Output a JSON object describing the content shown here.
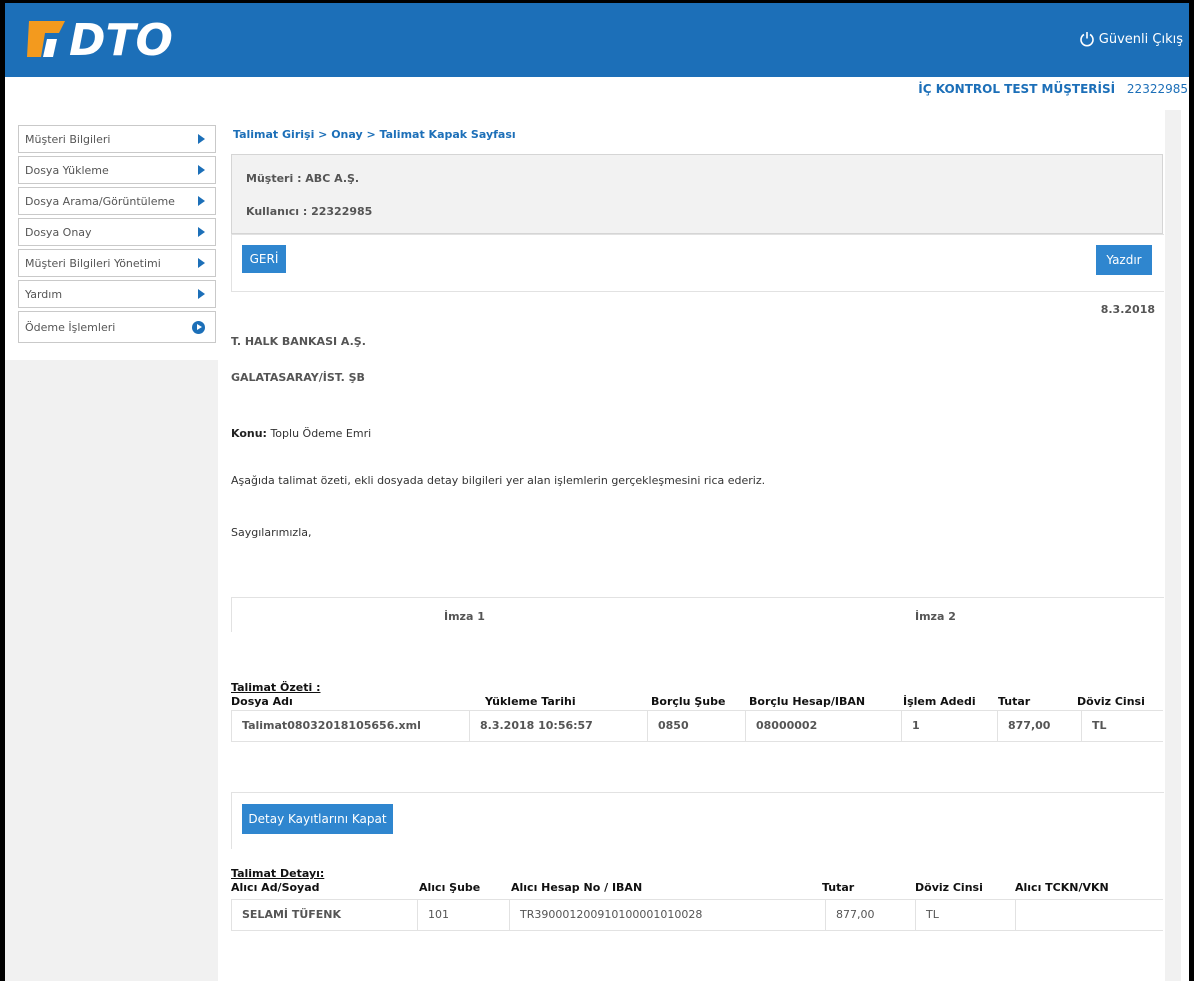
{
  "header": {
    "logo_text": "DTO",
    "logout_label": "Güvenli Çıkış"
  },
  "customer": {
    "name": "İÇ KONTROL TEST MÜŞTERİSİ",
    "number": "22322985"
  },
  "sidebar": {
    "items": [
      {
        "label": "Müşteri Bilgileri"
      },
      {
        "label": "Dosya Yükleme"
      },
      {
        "label": "Dosya Arama/Görüntüleme"
      },
      {
        "label": "Dosya Onay"
      },
      {
        "label": "Müşteri Bilgileri Yönetimi"
      },
      {
        "label": "Yardım"
      },
      {
        "label": "Ödeme İşlemleri"
      }
    ]
  },
  "breadcrumb": "Talimat Girişi > Onay > Talimat Kapak Sayfası",
  "info": {
    "customer_line": "Müşteri : ABC A.Ş.",
    "user_line": "Kullanıcı : 22322985"
  },
  "buttons": {
    "back": "GERİ",
    "print": "Yazdır",
    "close_details": "Detay Kayıtlarını Kapat"
  },
  "letter": {
    "date": "8.3.2018",
    "bank": "T. HALK BANKASI A.Ş.",
    "branch": "GALATASARAY/İST. ŞB",
    "subject_label": "Konu:",
    "subject": "Toplu Ödeme Emri",
    "body": "Aşağıda talimat özeti, ekli dosyada detay bilgileri yer alan işlemlerin gerçekleşmesini rica ederiz.",
    "regards": "Saygılarımızla,"
  },
  "signatures": {
    "sign1": "İmza 1",
    "sign2": "İmza 2"
  },
  "summary": {
    "title": "Talimat Özeti :",
    "headers": [
      "Dosya Adı",
      "Yükleme Tarihi",
      "Borçlu Şube",
      "Borçlu Hesap/IBAN",
      "İşlem Adedi",
      "Tutar",
      "Döviz Cinsi"
    ],
    "row": [
      "Talimat08032018105656.xml",
      "8.3.2018 10:56:57",
      "0850",
      "08000002",
      "1",
      "877,00",
      "TL"
    ]
  },
  "detail": {
    "title": "Talimat Detayı:",
    "headers": [
      "Alıcı Ad/Soyad",
      "Alıcı Şube",
      "Alıcı Hesap No / IBAN",
      "Tutar",
      "Döviz Cinsi",
      "Alıcı TCKN/VKN"
    ],
    "row": [
      "SELAMİ TÜFENK",
      "101",
      "TR390001200910100001010028",
      "877,00",
      "TL",
      ""
    ]
  },
  "colors": {
    "brand_blue": "#1c6fb8",
    "button_blue": "#2f86cf",
    "logo_orange": "#f39a1e"
  }
}
